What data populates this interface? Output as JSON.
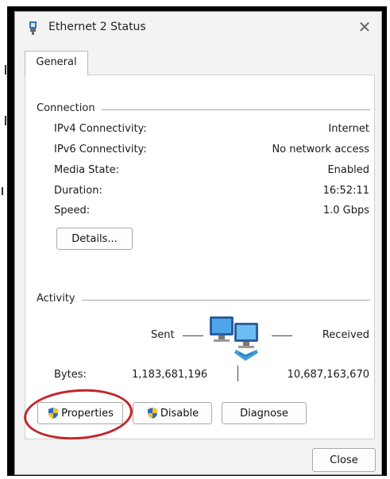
{
  "window": {
    "title": "Ethernet 2 Status",
    "close_glyph": "✕"
  },
  "tabs": [
    {
      "label": "General"
    }
  ],
  "connection": {
    "group_label": "Connection",
    "rows": [
      {
        "label": "IPv4 Connectivity:",
        "value": "Internet"
      },
      {
        "label": "IPv6 Connectivity:",
        "value": "No network access"
      },
      {
        "label": "Media State:",
        "value": "Enabled"
      },
      {
        "label": "Duration:",
        "value": "16:52:11"
      },
      {
        "label": "Speed:",
        "value": "1.0 Gbps"
      }
    ],
    "details_button": "Details..."
  },
  "activity": {
    "group_label": "Activity",
    "sent_label": "Sent",
    "received_label": "Received",
    "bytes_label": "Bytes:",
    "bytes_sent": "1,183,681,196",
    "bytes_received": "10,687,163,670"
  },
  "buttons": {
    "properties": "Properties",
    "disable": "Disable",
    "diagnose": "Diagnose",
    "close": "Close"
  },
  "icons": {
    "title": "ethernet-adapter-icon",
    "network": "network-computers-icon",
    "shield": "uac-shield-icon"
  },
  "colors": {
    "annotation": "#c0272d",
    "dialog_bg": "#f3f3f3",
    "panel_bg": "#ffffff"
  }
}
